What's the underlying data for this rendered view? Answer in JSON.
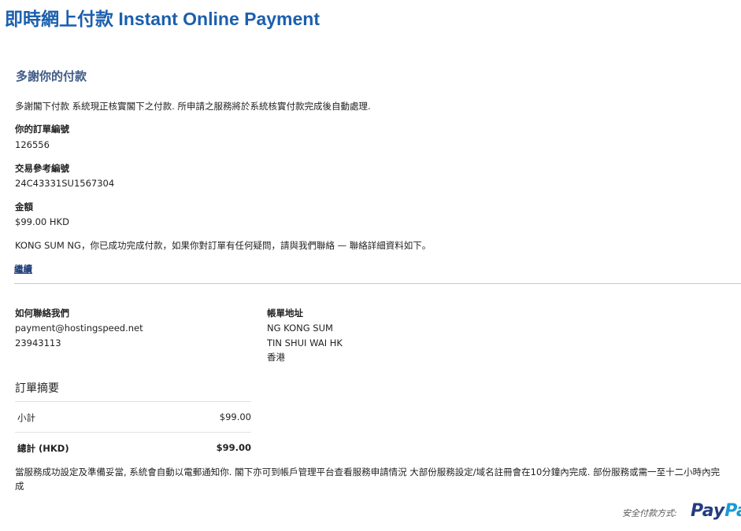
{
  "header": {
    "title": "即時網上付款 Instant Online Payment"
  },
  "confirmation": {
    "heading": "多謝你的付款",
    "message": "多謝閣下付款 系統現正核實閣下之付款. 所申請之服務將於系統核實付款完成後自動處理.",
    "order_number_label": "你的訂單編號",
    "order_number": "126556",
    "transaction_ref_label": "交易參考編號",
    "transaction_ref": "24C43331SU1567304",
    "amount_label": "金額",
    "amount": "$99.00 HKD",
    "success_text": "KONG SUM NG，你已成功完成付款，如果你對訂單有任何疑問，請與我們聯絡 — 聯絡詳細資料如下。",
    "continue_link": "繼續"
  },
  "contact": {
    "label": "如何聯絡我們",
    "email": "payment@hostingspeed.net",
    "phone": "23943113"
  },
  "billing": {
    "label": "帳單地址",
    "name": "NG KONG SUM",
    "address": "TIN SHUI WAI HK",
    "region": "香港"
  },
  "summary": {
    "heading": "訂單摘要",
    "subtotal_label": "小計",
    "subtotal_value": "$99.00",
    "total_label": "總計 (HKD)",
    "total_value": "$99.00"
  },
  "footer": {
    "note_line1": "當服務成功設定及準備妥當, 系統會自動以電郵通知你. 閣下亦可到帳戶管理平台查看服務申請情況 大部份服務設定/域名註冊會在10分鐘內完成. 部份服務或需一至十二小時內完",
    "note_line2": "成",
    "secure_label": "安全付款方式:",
    "paypal_part1": "Pay",
    "paypal_part2": "Pal"
  }
}
